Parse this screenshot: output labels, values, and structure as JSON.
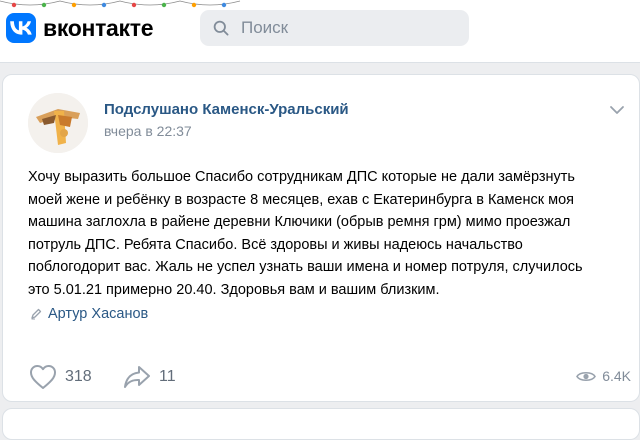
{
  "header": {
    "logo_text": "вконтакте",
    "search_placeholder": "Поиск"
  },
  "post": {
    "author": "Подслушано Каменск-Уральский",
    "date": "вчера в 22:37",
    "text_lines": [
      "Хочу выразить большое Спасибо сотрудникам ДПС которые не дали замёрзнуть",
      "моей жене и ребёнку в возрасте 8 месяцев, ехав с Екатеринбурга в Каменск моя",
      "машина заглохла в райене деревни Ключики (обрыв ремня грм) мимо проезжал",
      "потруль ДПС. Ребята Спасибо. Всё здоровы и живы надеюсь начальство",
      "поблогодорит вас. Жаль не успел узнать ваши имена и номер потруля, случилось",
      "это 5.01.21 примерно 20.40. Здоровья вам и вашим близким."
    ],
    "signer": "Артур Хасанов",
    "likes": "318",
    "shares": "11",
    "views": "6.4K"
  },
  "colors": {
    "link": "#2a5885",
    "brand": "#0077ff",
    "background": "#edeef0"
  }
}
